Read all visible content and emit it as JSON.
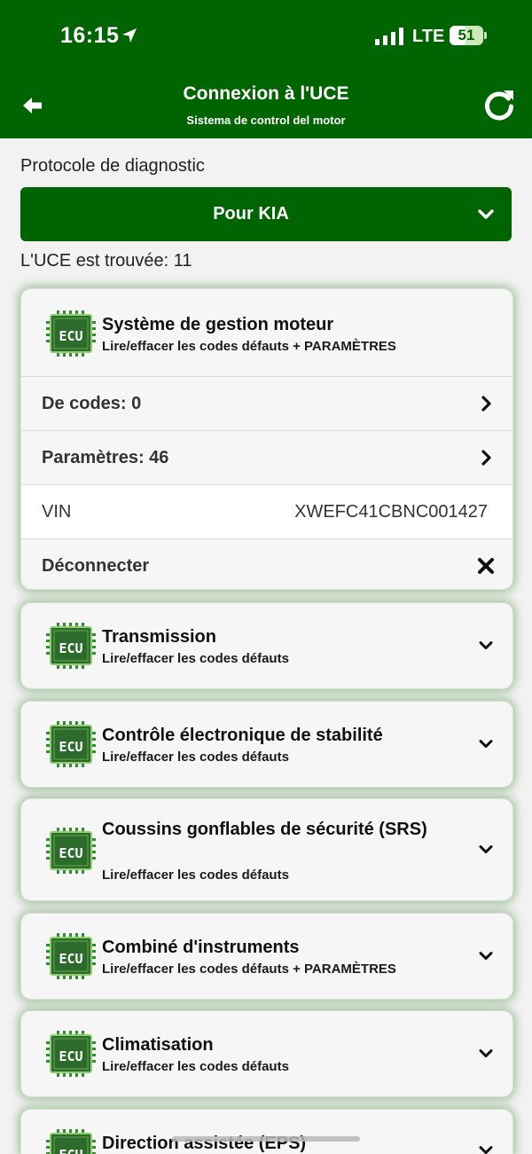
{
  "status_bar": {
    "time": "16:15",
    "network": "LTE",
    "battery": "51",
    "battery_level": 0.51
  },
  "nav": {
    "title": "Connexion à l'UCE",
    "subtitle": "Sistema de control del motor"
  },
  "protocol": {
    "label": "Protocole de diagnostic",
    "value": "Pour KIA"
  },
  "ecu_count_text": "L'UCE est trouvée: 11",
  "ecu_icon_text": "ECU",
  "colors": {
    "primary": "#006400",
    "card_glow": "#469c3c"
  },
  "expanded_card": {
    "title": "Système de gestion moteur",
    "subtitle": "Lire/effacer les codes défauts + PARAMÈTRES",
    "rows": {
      "codes": "De codes: 0",
      "params": "Paramètres: 46",
      "vin_label": "VIN",
      "vin_value": "XWEFC41CBNC001427",
      "disconnect": "Déconnecter"
    }
  },
  "cards": [
    {
      "title": "Transmission",
      "subtitle": "Lire/effacer les codes défauts"
    },
    {
      "title": "Contrôle électronique de stabilité",
      "subtitle": "Lire/effacer les codes défauts"
    },
    {
      "title": "Coussins gonflables de sécurité (SRS)",
      "subtitle": "Lire/effacer les codes défauts"
    },
    {
      "title": "Combiné d'instruments",
      "subtitle": "Lire/effacer les codes défauts + PARAMÈTRES"
    },
    {
      "title": "Climatisation",
      "subtitle": "Lire/effacer les codes défauts"
    },
    {
      "title": "Direction assistée (EPS)"
    }
  ]
}
